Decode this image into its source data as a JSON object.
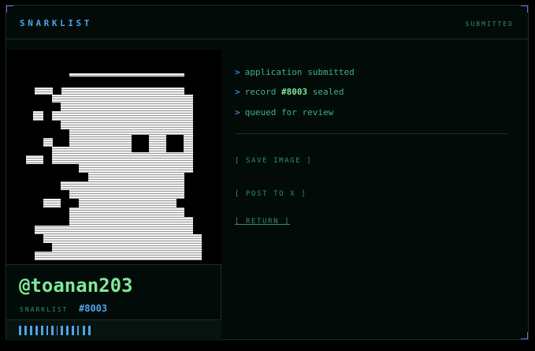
{
  "header": {
    "brand": "SNARKLIST",
    "status": "SUBMITTED"
  },
  "profile": {
    "handle": "@toanan203",
    "list_label": "SNARKLIST",
    "record_number": "#8003"
  },
  "log": [
    {
      "prefix": ">",
      "text": "application submitted"
    },
    {
      "prefix": ">",
      "pre": "record",
      "highlight": "#8003",
      "post": "sealed"
    },
    {
      "prefix": ">",
      "text": "queued for review"
    }
  ],
  "actions": {
    "save_image": "[ SAVE IMAGE ]",
    "post_to_x": "[ POST TO X ]",
    "return": "[ RETURN ]"
  },
  "colors": {
    "background": "#020b08",
    "accent_blue": "#4fa3e6",
    "accent_green": "#7fe89a",
    "muted_green": "#2f8f6a",
    "border": "#16302a"
  },
  "icons": {
    "avatar": "pixel-ghost-avatar",
    "barcode": "barcode-icon"
  }
}
